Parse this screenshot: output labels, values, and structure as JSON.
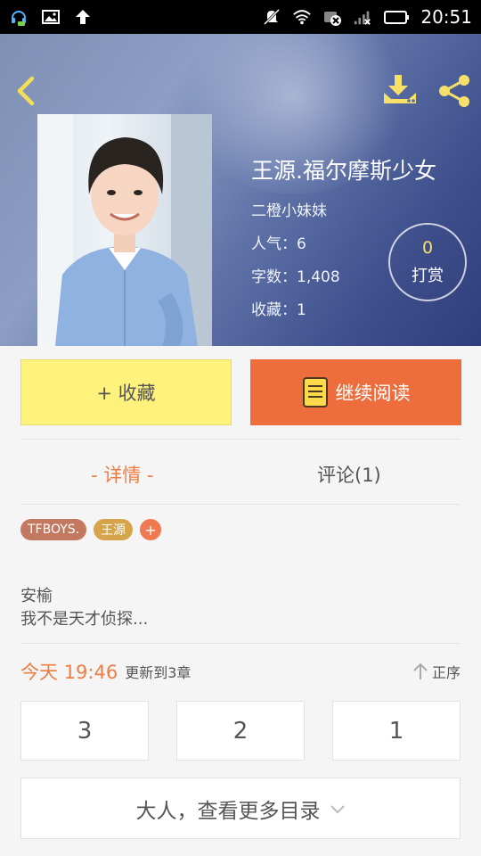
{
  "status_bar": {
    "time": "20:51",
    "icons": [
      "headset-notification-icon",
      "image-notification-icon",
      "upload-notification-icon",
      "mute-icon",
      "wifi-icon",
      "data-off-icon",
      "signal-icon",
      "battery-icon"
    ]
  },
  "header": {
    "back_icon": "chevron-left-icon",
    "download_icon": "download-icon",
    "share_icon": "share-icon"
  },
  "book": {
    "title": "王源.福尔摩斯少女",
    "author": "二橙小妹妹",
    "popularity": "人气：6",
    "word_count": "字数：1,408",
    "favorites": "收藏：1"
  },
  "reward": {
    "count": "0",
    "label": "打赏"
  },
  "actions": {
    "favorite_label": "+ 收藏",
    "continue_label": "继续阅读"
  },
  "tabs": {
    "detail": "- 详情 -",
    "comments": "评论(1)"
  },
  "tags": [
    "TFBOYS.",
    "王源"
  ],
  "tag_add": "+",
  "description": {
    "line1": "安榆",
    "line2": "我不是天才侦探..."
  },
  "update": {
    "time": "今天 19:46",
    "text": "更新到3章",
    "sort_label": "正序"
  },
  "chapters": [
    "3",
    "2",
    "1"
  ],
  "more_label": "大人，查看更多目录",
  "colors": {
    "accent_orange": "#ee6d3d",
    "favorite_yellow": "#fff27c",
    "icon_yellow": "#f7e06a"
  }
}
